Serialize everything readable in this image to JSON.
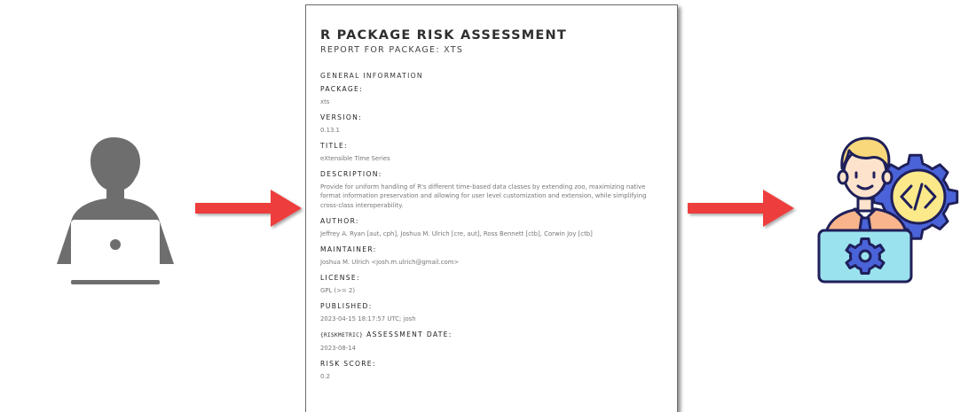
{
  "colors": {
    "arrow": "#ee3e3e",
    "user_silhouette": "#6e6e6e",
    "doc_border": "#6d6d6d",
    "dev_skin": "#fee3cc",
    "dev_hair": "#f8d87a",
    "dev_shirt": "#f9b48c",
    "dev_laptop": "#9ae2ee",
    "dev_gear": "#4a63d8",
    "dev_code_gear_fill": "#fbe98a",
    "outline": "#1f1f5a"
  },
  "icons": {
    "left": "user-laptop-icon",
    "right": "developer-code-gear-icon"
  },
  "doc": {
    "title": "R PACKAGE RISK ASSESSMENT",
    "subtitle": "REPORT FOR PACKAGE: XTS",
    "section": "GENERAL INFORMATION",
    "fields": {
      "package": {
        "label": "PACKAGE:",
        "value": "xts"
      },
      "version": {
        "label": "VERSION:",
        "value": "0.13.1"
      },
      "title": {
        "label": "TITLE:",
        "value": "eXtensible Time Series"
      },
      "description": {
        "label": "DESCRIPTION:",
        "value": "Provide for uniform handling of R's different time-based data classes by extending zoo, maximizing native format information preservation and allowing for user level customization and extension, while simplifying cross-class interoperability."
      },
      "author": {
        "label": "AUTHOR:",
        "value": "Jeffrey A. Ryan [aut, cph], Joshua M. Ulrich [cre, aut], Ross Bennett [ctb], Corwin Joy [ctb]"
      },
      "maintainer": {
        "label": "MAINTAINER:",
        "value": "Joshua M. Ulrich <josh.m.ulrich@gmail.com>"
      },
      "license": {
        "label": "LICENSE:",
        "value": "GPL (>= 2)"
      },
      "published": {
        "label": "PUBLISHED:",
        "value": "2023-04-15 18:17:57 UTC; josh"
      },
      "assessment_date": {
        "tag": "{RISKMETRIC}",
        "label": "ASSESSMENT DATE:",
        "value": "2023-08-14"
      },
      "risk_score": {
        "label": "RISK SCORE:",
        "value": "0.2"
      }
    }
  }
}
